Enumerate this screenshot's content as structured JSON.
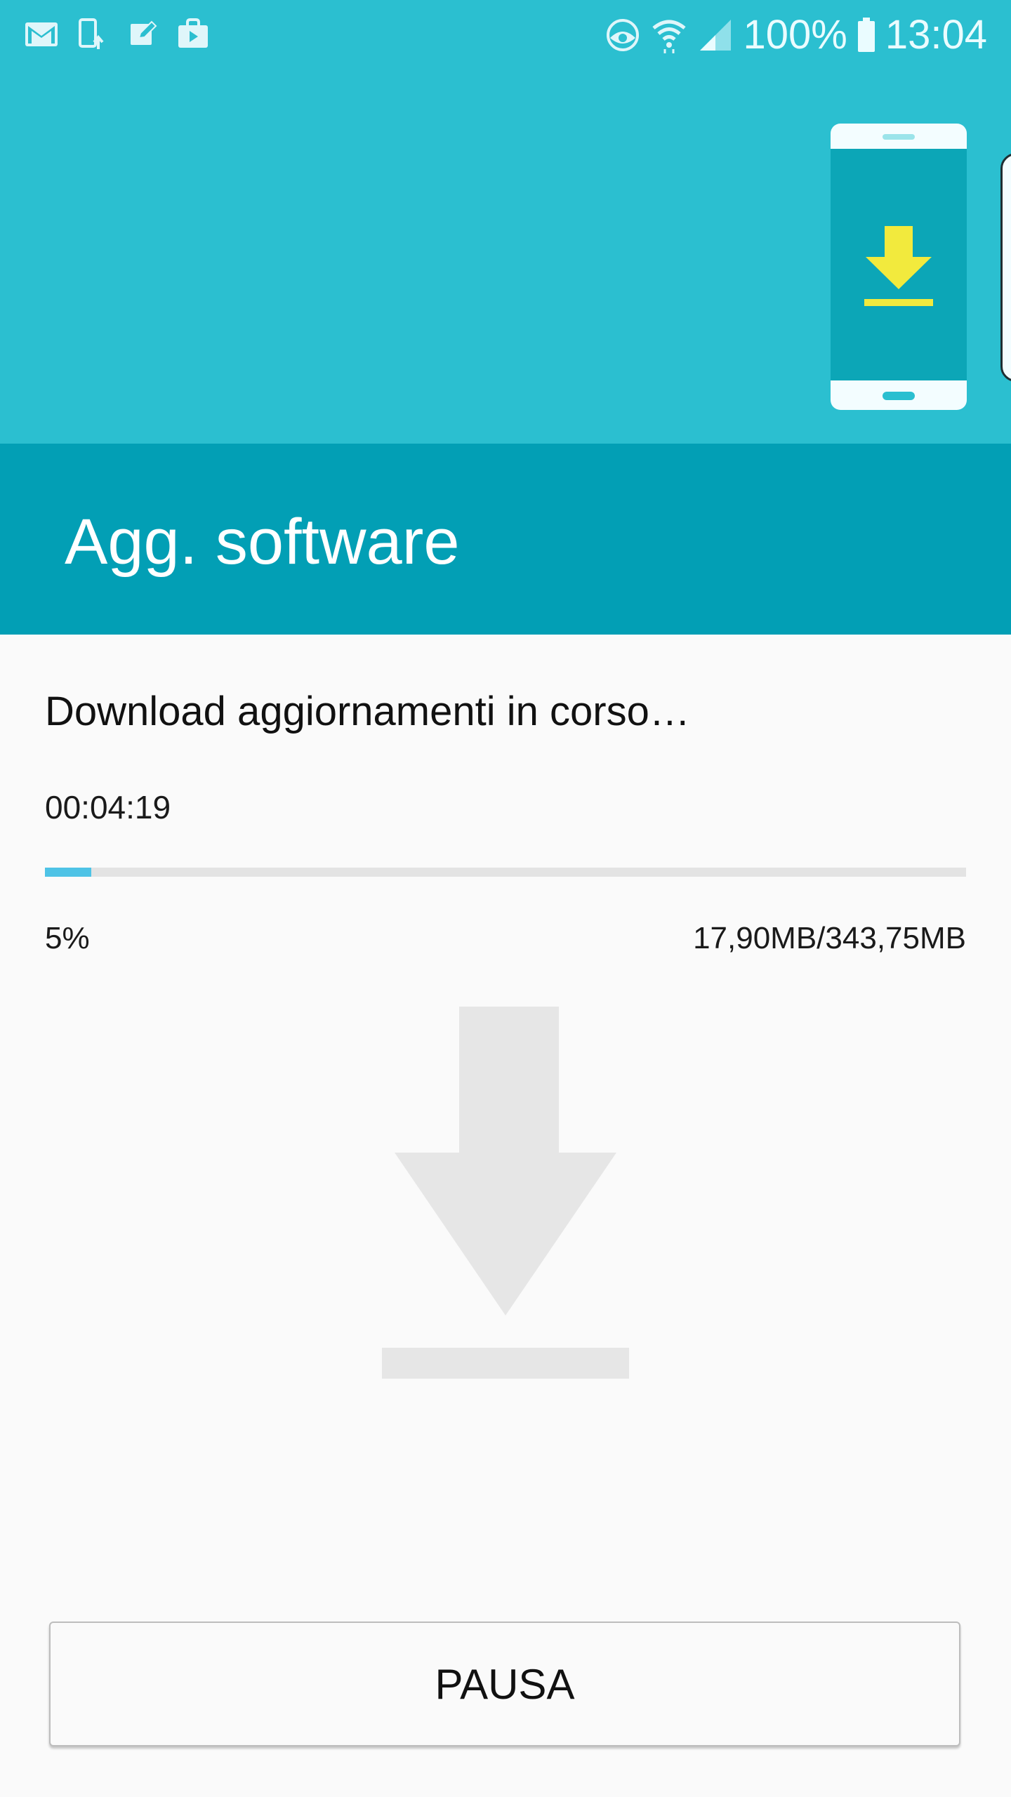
{
  "status_bar": {
    "left_icons": [
      "gmail-icon",
      "device-update-icon",
      "note-edit-icon",
      "play-store-bag-icon"
    ],
    "right_icons": [
      "eye-comfort-icon",
      "wifi-icon",
      "cellular-signal-icon",
      "battery-icon"
    ],
    "battery": "100%",
    "time": "13:04"
  },
  "header": {
    "title": "Agg. software",
    "illustration": "phone-download-illustration",
    "background_color": "#2bbfd0",
    "title_band_color": "#029fb5",
    "arrow_color": "#f2ea3d"
  },
  "download": {
    "status": "Download aggiornamenti in corso…",
    "elapsed": "00:04:19",
    "progress_percent": 5,
    "percent_label": "5%",
    "size_label": "17,90MB/343,75MB",
    "progress_color": "#4ec3e6",
    "illustration": "download-arrow-icon"
  },
  "actions": {
    "pause_label": "PAUSA"
  }
}
